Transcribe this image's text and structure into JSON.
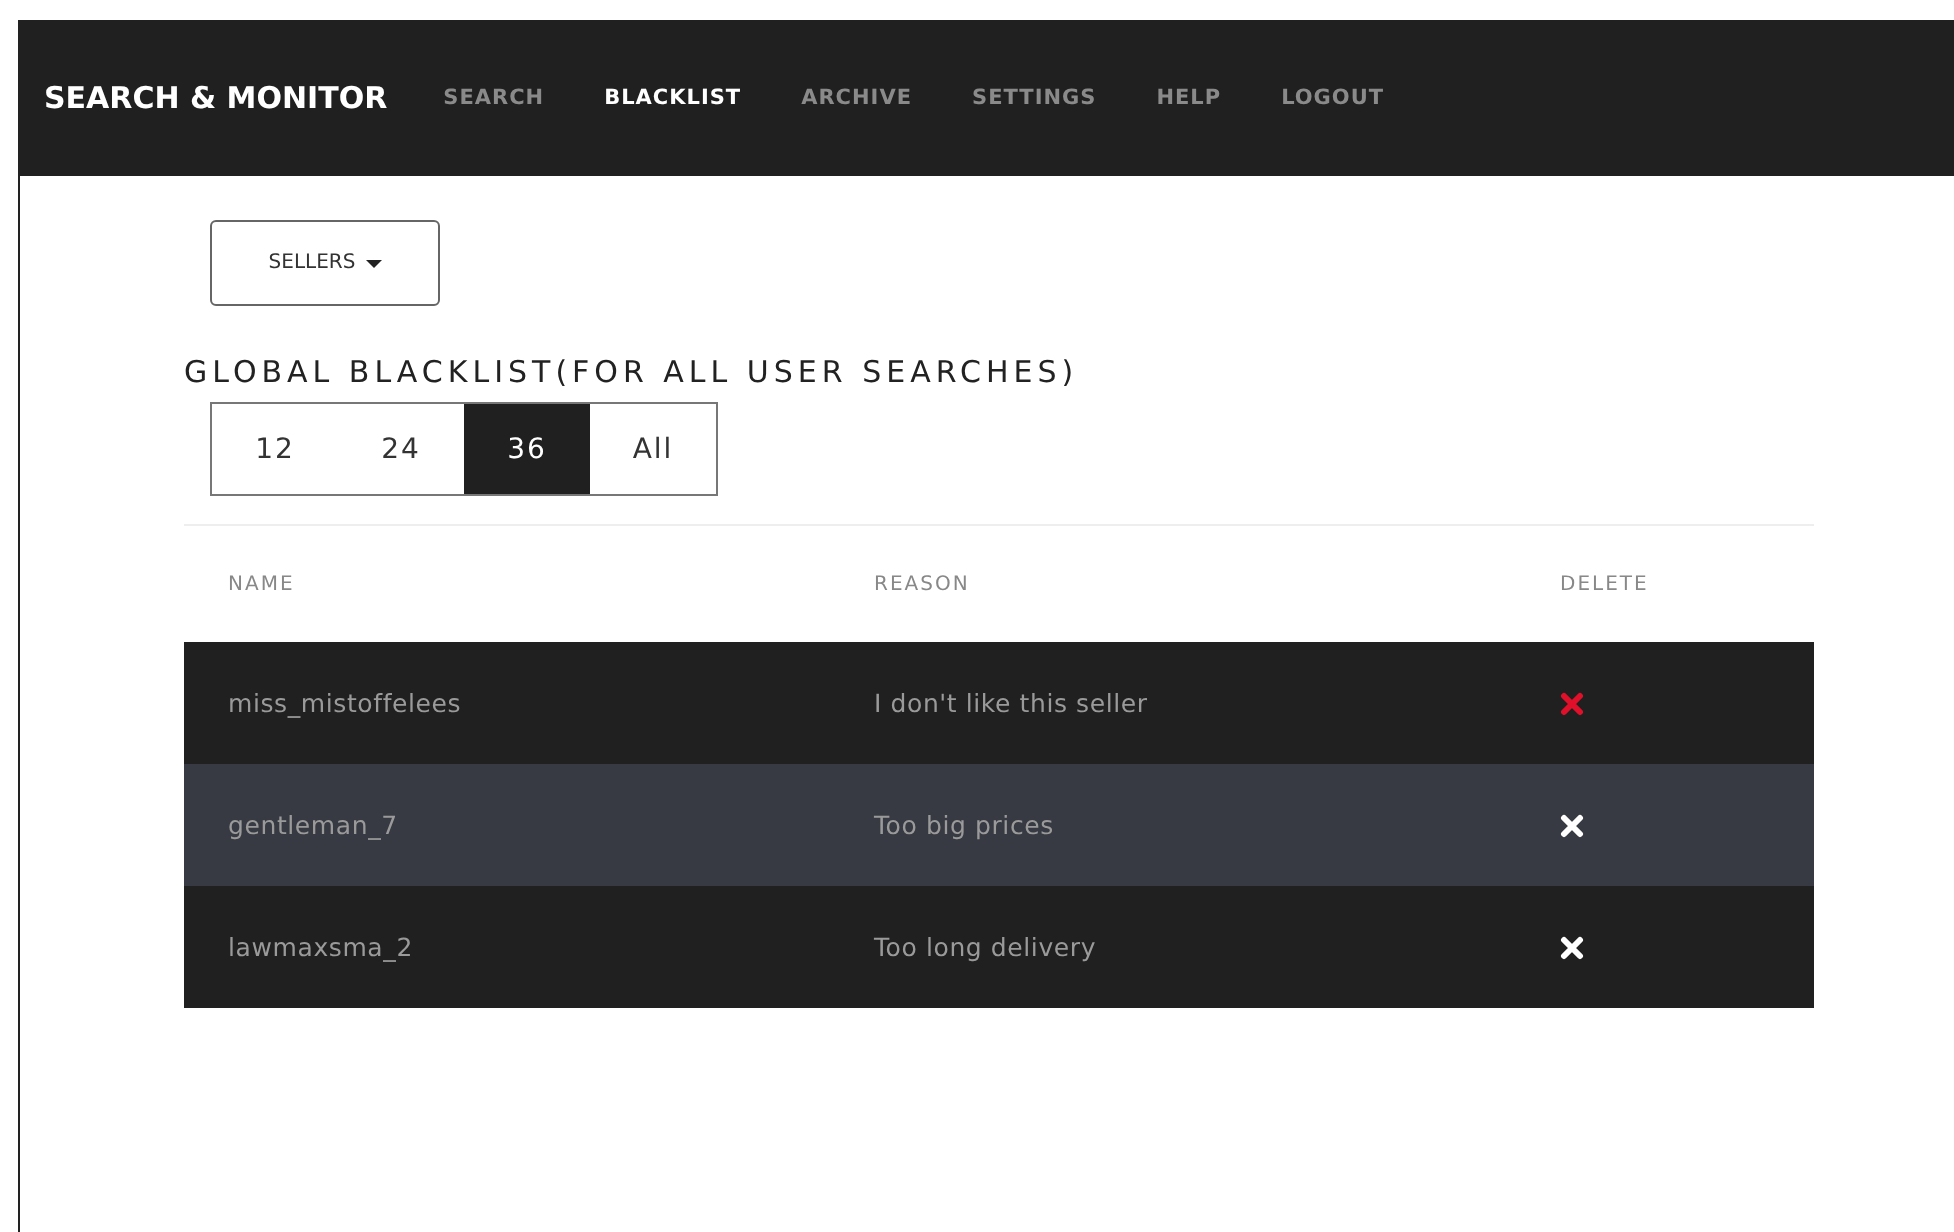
{
  "nav": {
    "brand": "SEARCH & MONITOR",
    "items": [
      {
        "label": "SEARCH",
        "selected": false
      },
      {
        "label": "BLACKLIST",
        "selected": true
      },
      {
        "label": "ARCHIVE",
        "selected": false
      },
      {
        "label": "SETTINGS",
        "selected": false
      },
      {
        "label": "HELP",
        "selected": false
      },
      {
        "label": "LOGOUT",
        "selected": false
      }
    ]
  },
  "filter": {
    "label": "SELLERS"
  },
  "title": "GLOBAL BLACKLIST(FOR ALL USER SEARCHES)",
  "page_sizes": [
    {
      "label": "12",
      "selected": false
    },
    {
      "label": "24",
      "selected": false
    },
    {
      "label": "36",
      "selected": true
    },
    {
      "label": "All",
      "selected": false
    }
  ],
  "table": {
    "columns": [
      "NAME",
      "REASON",
      "DELETE"
    ],
    "rows": [
      {
        "name": "miss_mistoffelees",
        "reason": "I don't like this seller",
        "highlighted": false,
        "delete_hovered": true
      },
      {
        "name": "gentleman_7",
        "reason": "Too big prices",
        "highlighted": true,
        "delete_hovered": false
      },
      {
        "name": "lawmaxsma_2",
        "reason": "Too long delivery",
        "highlighted": false,
        "delete_hovered": false
      }
    ]
  }
}
